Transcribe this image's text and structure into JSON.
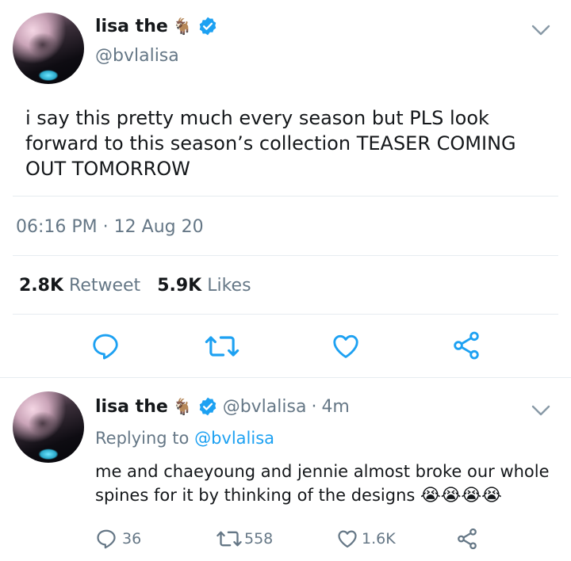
{
  "tweet": {
    "author_name": "lisa the",
    "author_emoji": "🐐",
    "handle": "@bvlalisa",
    "text_lines": [
      "i say this pretty much every season but PLS look",
      "forward to this season’s collection TEASER COMING",
      "OUT TOMORROW"
    ],
    "time": "06:16 PM",
    "separator": "·",
    "date": "12 Aug 20",
    "retweets_count": "2.8K",
    "retweets_label": "Retweet",
    "likes_count": "5.9K",
    "likes_label": "Likes"
  },
  "reply": {
    "author_name": "lisa the",
    "author_emoji": "🐐",
    "handle": "@bvlalisa",
    "time_sep": "·",
    "age": "4m",
    "replying_prefix": "Replying to",
    "replying_to": "@bvlalisa",
    "text_line1": "me and chaeyoung and jennie almost broke our whole",
    "text_line2": "spines for it by thinking of the designs",
    "text_emojis": "😭😭😭😭",
    "replies_count": "36",
    "retweets_count": "558",
    "likes_count": "1.6K"
  },
  "colors": {
    "verified": "#1da1f2",
    "icon": "#1da1f2",
    "muted": "#657786",
    "divider": "#e6ecf0"
  },
  "icons": [
    "verified-badge-icon",
    "chevron-down-icon",
    "reply-icon",
    "retweet-icon",
    "like-icon",
    "share-icon"
  ]
}
